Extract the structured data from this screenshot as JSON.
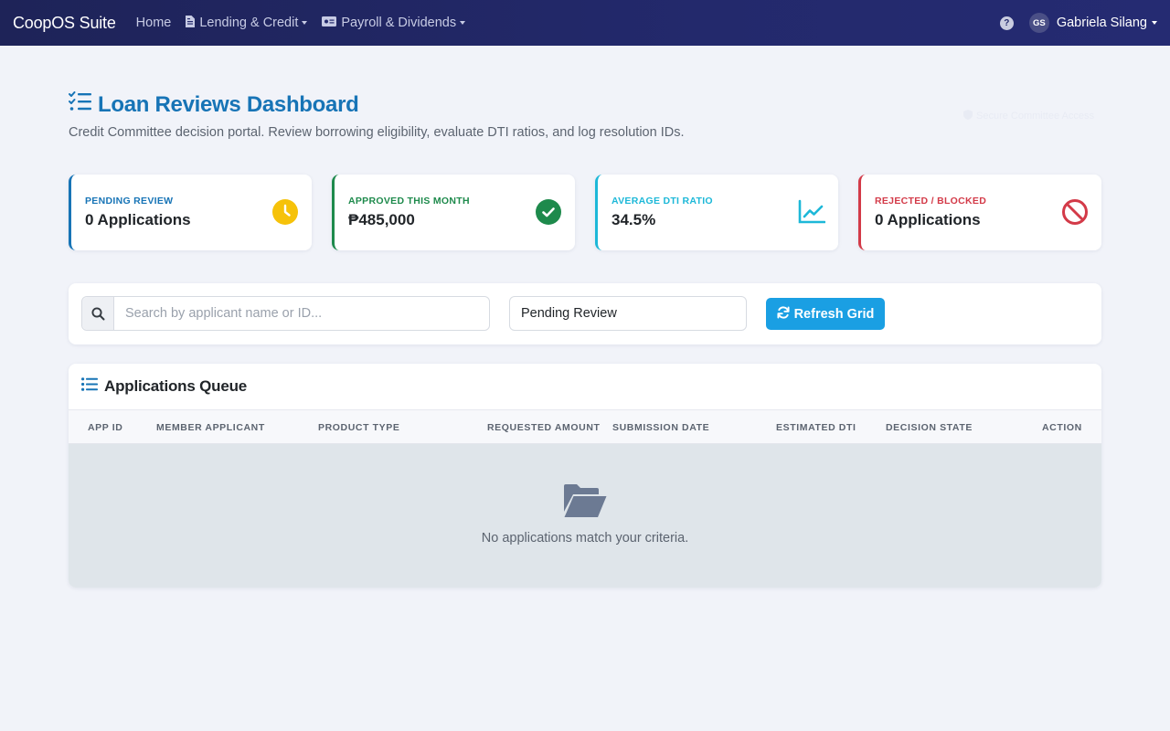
{
  "navbar": {
    "brand": "CoopOS Suite",
    "items": [
      {
        "label": "Home",
        "icon": "none",
        "dropdown": false
      },
      {
        "label": "Lending & Credit",
        "icon": "file-invoice-icon",
        "dropdown": true
      },
      {
        "label": "Payroll & Dividends",
        "icon": "money-bill-icon",
        "dropdown": true
      }
    ],
    "user": {
      "initials": "GS",
      "name": "Gabriela Silang"
    },
    "help_symbol": "?"
  },
  "header": {
    "title": "Loan Reviews Dashboard",
    "subtitle": "Credit Committee decision portal. Review borrowing eligibility, evaluate DTI ratios, and log resolution IDs.",
    "security_badge": "Secure Committee Access"
  },
  "stats": [
    {
      "label": "PENDING REVIEW",
      "value": "0 Applications",
      "icon": "clock-icon",
      "color": "#1774b6",
      "icon_color": "#f6c20a"
    },
    {
      "label": "APPROVED THIS MONTH",
      "value": "₱485,000",
      "icon": "check-circle-icon",
      "color": "#1e8a4c",
      "icon_color": "#1e8a4c"
    },
    {
      "label": "AVERAGE DTI RATIO",
      "value": "34.5%",
      "icon": "chart-line-icon",
      "color": "#1db8d8",
      "icon_color": "#1db8d8"
    },
    {
      "label": "REJECTED / BLOCKED",
      "value": "0 Applications",
      "icon": "ban-icon",
      "color": "#d33a48",
      "icon_color": "#d33a48"
    }
  ],
  "filters": {
    "search_placeholder": "Search by applicant name or ID...",
    "search_value": "",
    "status_selected": "Pending Review",
    "refresh_label": "Refresh Grid"
  },
  "queue": {
    "title": "Applications Queue",
    "columns": [
      "APP ID",
      "MEMBER APPLICANT",
      "PRODUCT TYPE",
      "REQUESTED AMOUNT",
      "SUBMISSION DATE",
      "ESTIMATED DTI",
      "DECISION STATE",
      "ACTION"
    ],
    "rows": [],
    "empty_message": "No applications match your criteria."
  },
  "colors": {
    "navbar": "#23296c",
    "accent": "#1774b6",
    "button": "#1a9fe3",
    "page_bg": "#f1f3f9"
  }
}
